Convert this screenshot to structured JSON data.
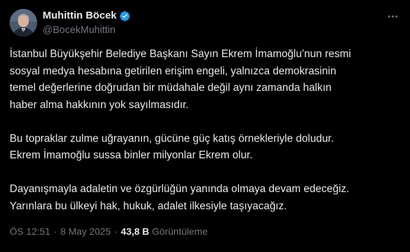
{
  "author": {
    "display_name": "Muhittin Böcek",
    "handle": "@BocekMuhittin",
    "verified_icon": "verified-badge-icon",
    "verified_color": "#1d9bf0"
  },
  "menu": {
    "icon": "more-horizontal-icon"
  },
  "tweet": {
    "lines": [
      "İstanbul Büyükşehir Belediye Başkanı Sayın Ekrem İmamoğlu’nun resmi",
      "sosyal medya hesabına getirilen erişim engeli, yalnızca demokrasinin",
      "temel değerlerine doğrudan bir müdahale değil aynı zamanda halkın",
      "haber alma hakkının yok sayılmasıdır.",
      "",
      "Bu topraklar zulme uğrayanın, gücüne güç katış örnekleriyle doludur.",
      "Ekrem İmamoğlu sussa binler milyonlar Ekrem olur.",
      "",
      "Dayanışmayla adaletin ve özgürlüğün yanında olmaya devam edeceğiz.",
      "Yarınlara bu ülkeyi hak, hukuk, adalet ilkesiyle taşıyacağız."
    ]
  },
  "meta": {
    "time": "ÖS 12:51",
    "separator": "·",
    "date": "8 May 2025",
    "views_count": "43,8 B",
    "views_label": "Görüntüleme"
  },
  "colors": {
    "background": "#000000",
    "text_primary": "#e7e9ea",
    "text_secondary": "#71767b",
    "accent": "#1d9bf0"
  }
}
